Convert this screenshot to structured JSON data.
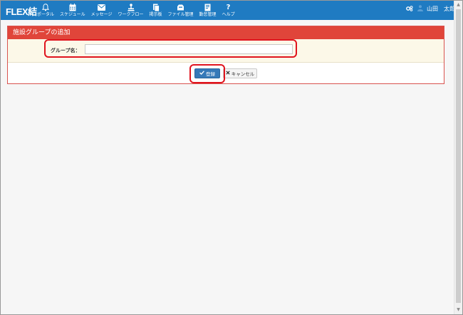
{
  "app": {
    "logo": "FLEX結"
  },
  "nav": {
    "items": [
      {
        "label": "ポータル",
        "icon": "bell-icon"
      },
      {
        "label": "スケジュール",
        "icon": "calendar-icon"
      },
      {
        "label": "メッセージ",
        "icon": "envelope-icon"
      },
      {
        "label": "ワークフロー",
        "icon": "workflow-icon"
      },
      {
        "label": "掲示板",
        "icon": "bulletin-icon"
      },
      {
        "label": "ファイル管理",
        "icon": "folder-icon"
      },
      {
        "label": "勤怠管理",
        "icon": "attendance-icon"
      },
      {
        "label": "ヘルプ",
        "icon": "help-icon"
      }
    ],
    "user_name": "山田　太郎"
  },
  "panel": {
    "title": "施設グループの追加",
    "group_name_label": "グループ名：",
    "group_name_value": "",
    "register_label": "登録",
    "cancel_label": "キャンセル"
  },
  "colors": {
    "nav_bg": "#1f7bc2",
    "panel_header": "#e0453a",
    "primary_button": "#3579b8",
    "highlight": "#e0141e"
  }
}
